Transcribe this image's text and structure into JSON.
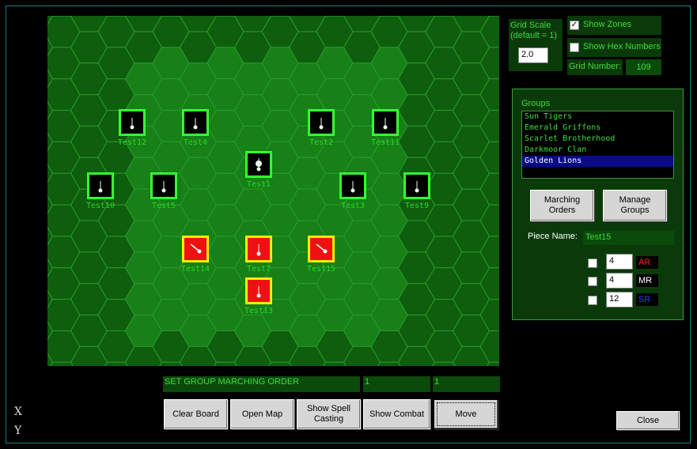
{
  "board": {
    "pieces": [
      {
        "id": "test12",
        "label": "Test12",
        "team": "green",
        "glyph": "pin"
      },
      {
        "id": "test4",
        "label": "Test4",
        "team": "green",
        "glyph": "pin"
      },
      {
        "id": "test2",
        "label": "Test2",
        "team": "green",
        "glyph": "pin"
      },
      {
        "id": "test11",
        "label": "Test11",
        "team": "green",
        "glyph": "pin"
      },
      {
        "id": "test1",
        "label": "Test1",
        "team": "green",
        "glyph": "diamond"
      },
      {
        "id": "test10",
        "label": "Test10",
        "team": "green",
        "glyph": "pin"
      },
      {
        "id": "test5",
        "label": "Test5",
        "team": "green",
        "glyph": "pin"
      },
      {
        "id": "test3",
        "label": "Test3",
        "team": "green",
        "glyph": "pin"
      },
      {
        "id": "test9",
        "label": "Test9",
        "team": "green",
        "glyph": "pin"
      },
      {
        "id": "test14",
        "label": "Test14",
        "team": "red",
        "glyph": "slash"
      },
      {
        "id": "test7",
        "label": "Test7",
        "team": "red",
        "glyph": "pin"
      },
      {
        "id": "test15",
        "label": "Test15",
        "team": "red",
        "glyph": "slash"
      },
      {
        "id": "test13",
        "label": "Test13",
        "team": "red",
        "glyph": "pin"
      }
    ]
  },
  "grid_scale": {
    "label_line1": "Grid Scale",
    "label_line2": "(default = 1)",
    "value": "2.0"
  },
  "show_zones": {
    "label": "Show Zones",
    "checked": true
  },
  "show_hex_numbers": {
    "label": "Show Hex Numbers",
    "checked": false
  },
  "grid_number": {
    "label": "Grid Number:",
    "value": "109"
  },
  "groups": {
    "title": "Groups",
    "items": [
      "Sun Tigers",
      "Emerald Griffons",
      "Scarlet Brotherhood",
      "Darkmoor Clan",
      "Golden Lions"
    ],
    "selected_index": 4,
    "marching_orders_label": [
      "Marching",
      "Orders"
    ],
    "manage_groups_label": [
      "Manage",
      "Groups"
    ]
  },
  "piece": {
    "name_label": "Piece Name:",
    "name_value": "Test15",
    "stats": [
      {
        "value": "4",
        "label": "AR",
        "color": "#ff2020"
      },
      {
        "value": "4",
        "label": "MR",
        "color": "#ffffff"
      },
      {
        "value": "12",
        "label": "SR",
        "color": "#2040ff"
      }
    ]
  },
  "status": {
    "message": "SET GROUP MARCHING ORDER",
    "field2": "1",
    "field3": "1"
  },
  "buttons": {
    "clear_board": "Clear Board",
    "open_map": "Open Map",
    "show_spell_casting": [
      "Show Spell",
      "Casting"
    ],
    "show_combat": "Show Combat",
    "move": "Move",
    "close": "Close"
  },
  "coords": {
    "x_label": "X",
    "y_label": "Y"
  },
  "colors": {
    "board_bg": "#0e5e0e",
    "hex_light": "#1a8a1a",
    "hex_dark": "#0e5e0e",
    "green_border": "#33ff33",
    "red_fill": "#ee1111",
    "red_border": "#ffee00"
  }
}
